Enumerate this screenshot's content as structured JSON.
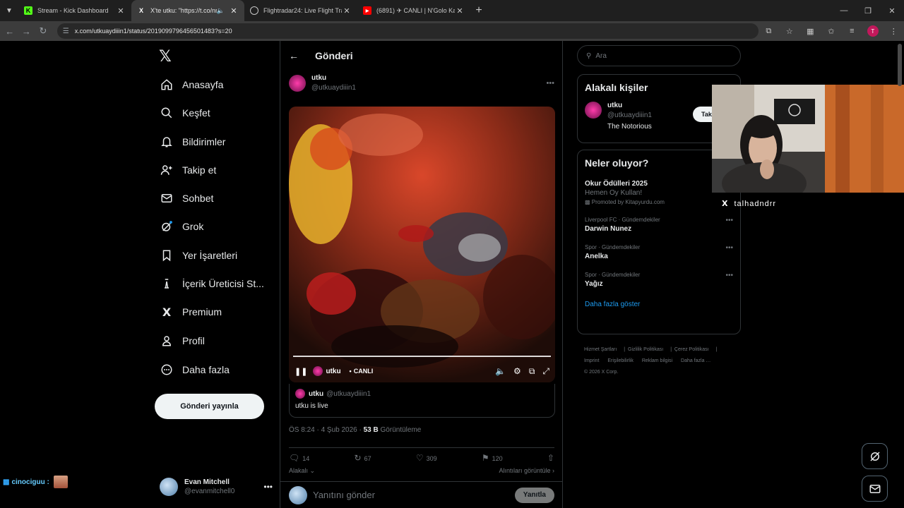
{
  "browser": {
    "tabs": [
      {
        "title": "Stream - Kick Dashboard",
        "icon": "kick-icon",
        "color": "#53fc18"
      },
      {
        "title": "X'te utku: \"https://t.co/nrff…",
        "icon": "x-icon",
        "color": "#ffffff"
      },
      {
        "title": "Flightradar24: Live Flight Track…",
        "icon": "globe-icon",
        "color": "#ffffff"
      },
      {
        "title": "(6891) ✈ CANLI | N'Golo Kanté…",
        "icon": "youtube-icon",
        "color": "#ff0000"
      }
    ],
    "url": "x.com/utkuaydiiin1/status/2019099796456501483?s=20",
    "profile_initial": "T"
  },
  "nav": {
    "items": [
      {
        "label": "Anasayfa",
        "icon": "home-icon"
      },
      {
        "label": "Keşfet",
        "icon": "search-icon"
      },
      {
        "label": "Bildirimler",
        "icon": "bell-icon"
      },
      {
        "label": "Takip et",
        "icon": "add-user-icon"
      },
      {
        "label": "Sohbet",
        "icon": "mail-icon"
      },
      {
        "label": "Grok",
        "icon": "grok-icon"
      },
      {
        "label": "Yer İşaretleri",
        "icon": "bookmark-icon"
      },
      {
        "label": "İçerik Üreticisi St...",
        "icon": "creator-icon"
      },
      {
        "label": "Premium",
        "icon": "x-icon"
      },
      {
        "label": "Profil",
        "icon": "person-icon"
      },
      {
        "label": "Daha fazla",
        "icon": "more-circle-icon"
      }
    ],
    "post_button": "Gönderi yayınla",
    "account": {
      "name": "Evan Mitchell",
      "handle": "@evanmitchell0"
    }
  },
  "chat": {
    "user": "cinociguu :",
    "color": "#66ccff"
  },
  "post": {
    "header_title": "Gönderi",
    "author_name": "utku",
    "author_handle": "@utkuaydiiin1",
    "video": {
      "author": "utku",
      "live_label": "CANLI",
      "progress": 1.0
    },
    "quote": {
      "name": "utku",
      "handle": "@utkuaydiiin1",
      "text": "utku is live"
    },
    "time": "ÖS 8:24 · 4 Şub 2026 ·",
    "views_count": "53 B",
    "views_label": "Görüntüleme",
    "stats": {
      "replies": "14",
      "reposts": "67",
      "likes": "309",
      "bookmarks": "120"
    },
    "related": "Alakalı",
    "quotes_link": "Alıntıları görüntüle",
    "reply_placeholder": "Yanıtını gönder",
    "reply_button": "Yanıtla"
  },
  "sidebar": {
    "search_placeholder": "Ara",
    "related_title": "Alakalı kişiler",
    "person": {
      "name": "utku",
      "handle": "@utkuaydiiin1",
      "bio": "The Notorious",
      "follow": "Tak"
    },
    "trends_title": "Neler oluyor?",
    "promoted": {
      "name": "Okur Ödülleri 2025",
      "sub": "Hemen Oy Kullan!",
      "promo": "Promoted by Kitapyurdu.com"
    },
    "trends": [
      {
        "category": "Liverpool FC · Gündemdekiler",
        "name": "Darwin Nunez"
      },
      {
        "category": "Spor · Gündemdekiler",
        "name": "Anelka"
      },
      {
        "category": "Spor · Gündemdekiler",
        "name": "Yağız"
      }
    ],
    "show_more": "Daha fazla göster",
    "footer": [
      "Hizmet Şartları",
      "Gizlilik Politikası",
      "Çerez Politikası",
      "Imprint",
      "Erişilebilirlik",
      "Reklam bilgisi",
      "Daha fazla …",
      "© 2026 X Corp."
    ]
  },
  "webcam": {
    "label": "talhadndrr"
  }
}
